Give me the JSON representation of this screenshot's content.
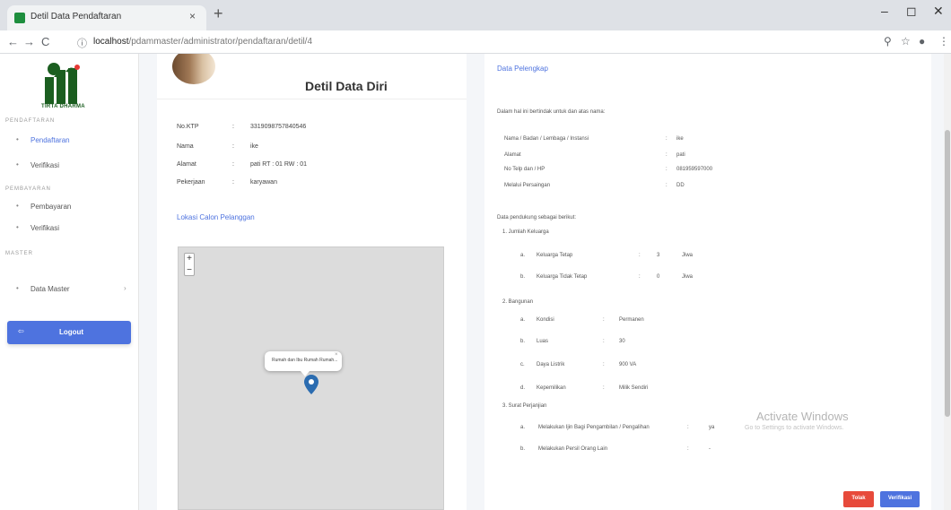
{
  "browser": {
    "tab_title": "Detil Data Pendaftaran",
    "tab_close": "×",
    "new_tab": "+",
    "url_host": "localhost",
    "url_path": "/pdammaster/administrator/pendaftaran/detil/4",
    "win_min": "–",
    "win_max": "◻",
    "win_close": "✕",
    "nav_back": "←",
    "nav_forward": "→",
    "nav_reload": "C",
    "info_icon": "ⓘ",
    "zoom_icon": "⚲",
    "star_icon": "☆",
    "profile_icon": "●",
    "menu_icon": "⋮"
  },
  "sidebar": {
    "logo_text": "TIRTA DHARMA",
    "section1": "PENDAFTARAN",
    "section2": "PEMBAYARAN",
    "section3": "MASTER",
    "items": [
      {
        "label": "Pendaftaran",
        "icon": "•",
        "active": true
      },
      {
        "label": "Verifikasi",
        "icon": "•"
      },
      {
        "label": "Pembayaran",
        "icon": "•"
      },
      {
        "label": "Verifikasi",
        "icon": "•"
      },
      {
        "label": "Data Master",
        "icon": "•",
        "chevron": "›"
      }
    ],
    "logout": "Logout",
    "logout_icon": "⇦"
  },
  "left_card": {
    "title": "Detil Data Diri",
    "rows": [
      {
        "key": "No.KTP",
        "colon": ":",
        "value": "3319098757840546"
      },
      {
        "key": "Nama",
        "colon": ":",
        "value": "ike"
      },
      {
        "key": "Alamat",
        "colon": ":",
        "value": "pati RT : 01 RW : 01"
      },
      {
        "key": "Pekerjaan",
        "colon": ":",
        "value": "karyawan"
      }
    ],
    "map_label": "Lokasi Calon Pelanggan",
    "zoom_in": "+",
    "zoom_out": "−",
    "popup_text": "Rumah dan Ibu Rumah Rumah...",
    "popup_close": "×"
  },
  "right_card": {
    "header": "Data Pelengkap",
    "intro": "Dalam hal ini bertindak untuk dan atas nama:",
    "identity": [
      {
        "k": "Nama / Badan / Lembaga / Instansi",
        "v": "ike"
      },
      {
        "k": "Alamat",
        "v": "pati"
      },
      {
        "k": "No Telp dan / HP",
        "v": "081959597000"
      },
      {
        "k": "Melalui Persaingan",
        "v": "DD"
      }
    ],
    "support_intro": "Data pendukung sebagai berikut:",
    "sec1": "1. Jumlah Keluarga",
    "family": [
      {
        "n": "a.",
        "k": "Keluarga Tetap",
        "v": "3",
        "u": "Jiwa"
      },
      {
        "n": "b.",
        "k": "Keluarga Tidak Tetap",
        "v": "0",
        "u": "Jiwa"
      }
    ],
    "sec2": "2. Bangunan",
    "building": [
      {
        "n": "a.",
        "k": "Kondisi",
        "v": "Permanen"
      },
      {
        "n": "b.",
        "k": "Luas",
        "v": "30"
      },
      {
        "n": "c.",
        "k": "Daya Listrik",
        "v": "900 VA"
      },
      {
        "n": "d.",
        "k": "Kepemilikan",
        "v": "Milik Sendiri"
      }
    ],
    "sec3": "3. Surat Perjanjian",
    "agreement": [
      {
        "n": "a.",
        "k": "Melakukan Ijin Bagi Pengambilan / Pengalihan",
        "v": "ya"
      },
      {
        "n": "b.",
        "k": "Melakukan Persil Orang Lain",
        "v": "-"
      }
    ],
    "btn_reject": "Tolak",
    "btn_verify": "Verifikasi"
  },
  "watermark": {
    "title": "Activate Windows",
    "sub": "Go to Settings to activate Windows."
  },
  "colors": {
    "accent": "#4e73df",
    "danger": "#e74a3b",
    "logo_green": "#1b5e20"
  }
}
